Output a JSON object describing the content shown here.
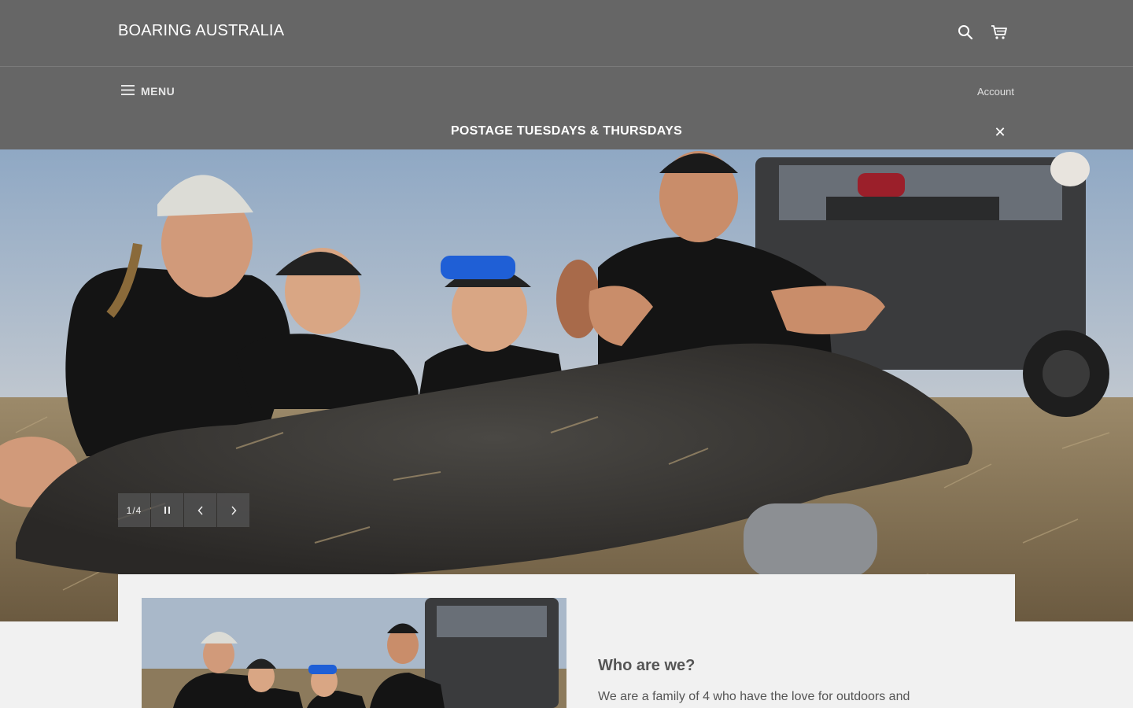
{
  "header": {
    "logo_text": "BOARING AUSTRALIA",
    "search_icon": "search-icon",
    "cart_icon": "cart-icon"
  },
  "nav": {
    "menu_label": "MENU",
    "menu_icon": "hamburger-icon",
    "account_label": "Account"
  },
  "announcement": {
    "text": "POSTAGE TUESDAYS & THURSDAYS",
    "close_icon": "close-icon"
  },
  "slideshow": {
    "counter": "1/4",
    "current": 1,
    "total": 4,
    "pause_icon": "pause-icon",
    "prev_icon": "chevron-left-icon",
    "next_icon": "chevron-right-icon",
    "image_description": "Family of four in black caps and shirts posing with a wild boar beside a side-by-side buggy in a grassy field"
  },
  "intro": {
    "heading": "Who are we?",
    "body": "We are a family of 4 who have the love for outdoors and"
  },
  "colors": {
    "header_bg": "#666666",
    "page_bg": "#f1f1f1",
    "text_dark": "#555555"
  }
}
